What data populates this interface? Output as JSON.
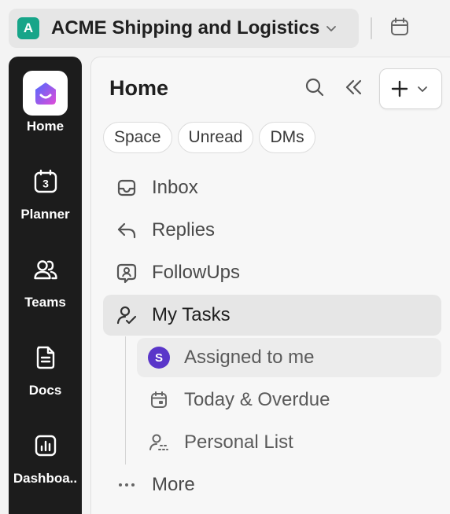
{
  "workspace": {
    "avatar_letter": "A",
    "name": "ACME Shipping and Logistics",
    "avatar_color": "#17a589",
    "chevron_icon": "chevron-down-icon"
  },
  "topbar": {
    "calendar_icon": "calendar-icon"
  },
  "rail": {
    "items": [
      {
        "label": "Home",
        "icon": "home-icon",
        "active": true
      },
      {
        "label": "Planner",
        "icon": "planner-calendar-icon",
        "badge": "3"
      },
      {
        "label": "Teams",
        "icon": "teams-icon"
      },
      {
        "label": "Docs",
        "icon": "docs-icon"
      },
      {
        "label": "Dashboa..",
        "icon": "dashboard-icon"
      }
    ]
  },
  "panel": {
    "title": "Home",
    "search_icon": "search-icon",
    "collapse_icon": "collapse-left-icon",
    "new_button_icon": "plus-icon",
    "filters": [
      "Space",
      "Unread",
      "DMs"
    ],
    "nav": [
      {
        "label": "Inbox",
        "icon": "inbox-icon"
      },
      {
        "label": "Replies",
        "icon": "reply-icon"
      },
      {
        "label": "FollowUps",
        "icon": "followup-icon"
      },
      {
        "label": "My Tasks",
        "icon": "my-tasks-icon",
        "selected": true
      }
    ],
    "sub_nav": [
      {
        "label": "Assigned to me",
        "avatar": "S",
        "avatar_color": "#5a36c9"
      },
      {
        "label": "Today & Overdue",
        "icon": "calendar-icon"
      },
      {
        "label": "Personal List",
        "icon": "personal-list-icon"
      }
    ],
    "more": {
      "label": "More",
      "icon": "more-dots-icon"
    }
  },
  "colors": {
    "rail_bg": "#1c1c1c",
    "panel_bg": "#f7f7f7",
    "selected_bg": "#e6e6e6",
    "brand_gradient": [
      "#4d6bff",
      "#e04bd8"
    ]
  }
}
